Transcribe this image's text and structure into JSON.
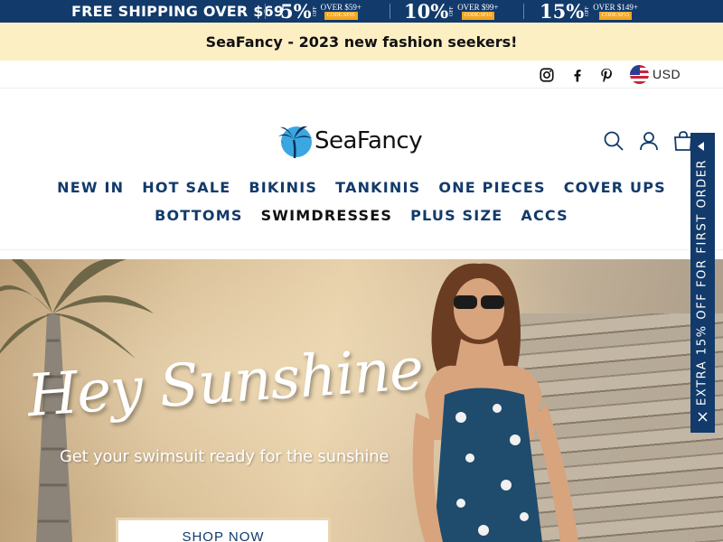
{
  "promo": {
    "shipping": "FREE SHIPPING OVER $69",
    "deals": [
      {
        "pct": "5%",
        "off": "OFF",
        "over": "OVER $59+",
        "code": "CODE:SF05"
      },
      {
        "pct": "10%",
        "off": "OFF",
        "over": "OVER $99+",
        "code": "CODE:SF10"
      },
      {
        "pct": "15%",
        "off": "OFF",
        "over": "OVER $149+",
        "code": "CODE:SF15"
      }
    ]
  },
  "announcement": "SeaFancy - 2023 new fashion seekers!",
  "utility": {
    "social_icons": [
      "instagram-icon",
      "facebook-icon",
      "pinterest-icon"
    ],
    "currency": "USD"
  },
  "header": {
    "brand": "SeaFancy",
    "icons": [
      "search-icon",
      "account-icon",
      "cart-icon"
    ]
  },
  "nav": {
    "row1": [
      "NEW IN",
      "HOT SALE",
      "BIKINIS",
      "TANKINIS",
      "ONE PIECES",
      "COVER UPS"
    ],
    "row2": [
      "BOTTOMS",
      "SWIMDRESSES",
      "PLUS SIZE",
      "ACCS"
    ]
  },
  "hero": {
    "headline": "Hey Sunshine",
    "subline": "Get your swimsuit ready for the sunshine",
    "cta": "SHOP NOW"
  },
  "side_tab": {
    "text": "EXTRA 15% OFF FOR FIRST ORDER"
  },
  "colors": {
    "brand_navy": "#123a6b",
    "announce_bg": "#fcefc4",
    "code_badge": "#f4a623"
  }
}
